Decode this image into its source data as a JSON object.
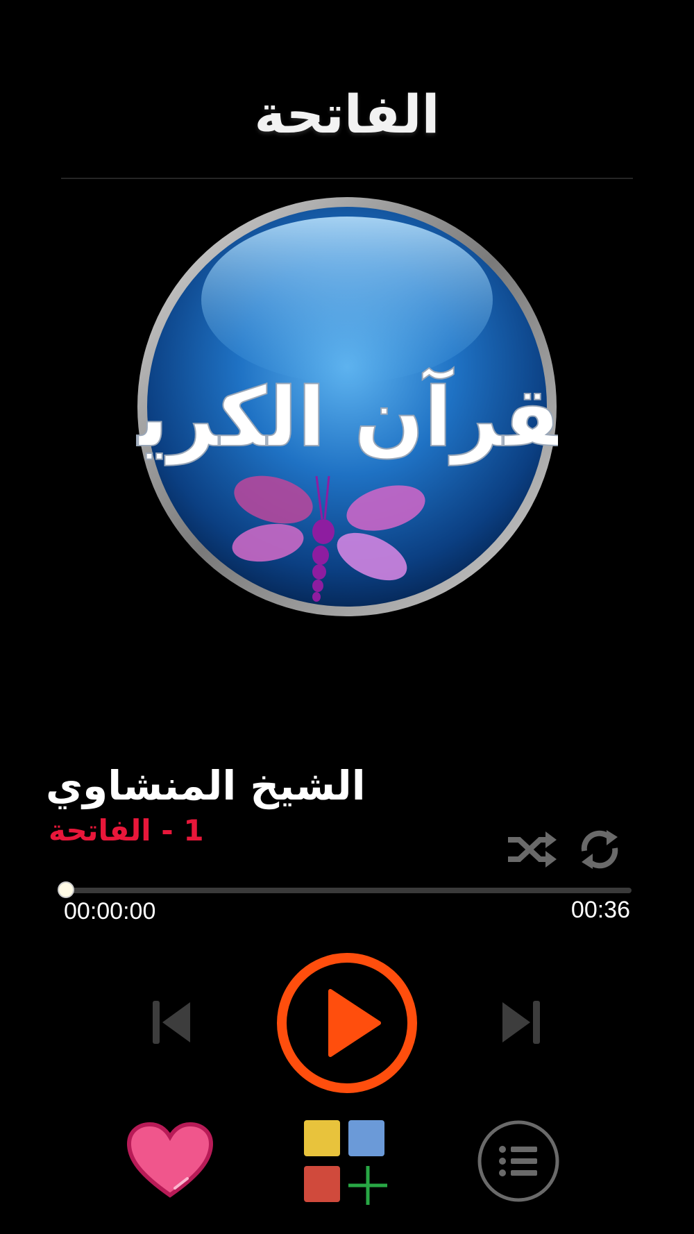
{
  "header": {
    "title": "الفاتحة"
  },
  "artwork": {
    "calligraphy": "القرآن الكريم"
  },
  "now_playing": {
    "reciter": "الشيخ المنشاوي",
    "track": "1 - الفاتحة",
    "progress": 0,
    "current_time": "00:00:00",
    "total_time": "00:36"
  },
  "controls": {
    "shuffle_icon": "shuffle-icon",
    "repeat_icon": "repeat-icon",
    "prev_icon": "skip-previous-icon",
    "play_icon": "play-icon",
    "next_icon": "skip-next-icon"
  },
  "bottom_bar": {
    "favorite_icon": "heart-icon",
    "more_apps_icon": "apps-grid-icon",
    "playlist_icon": "playlist-icon"
  },
  "colors": {
    "accent": "#ff4e0d",
    "track_title": "#e8173a",
    "heart": "#f0568c",
    "background": "#000000"
  }
}
